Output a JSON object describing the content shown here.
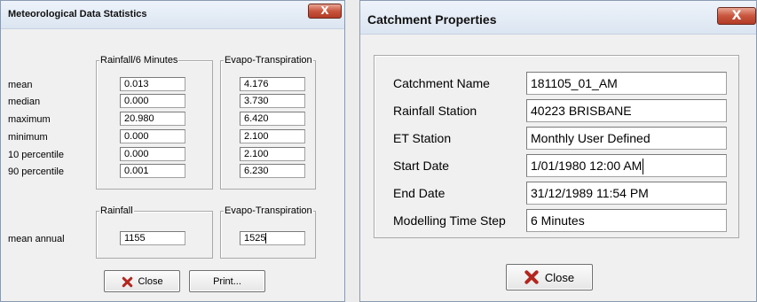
{
  "met_window": {
    "title": "Meteorological Data Statistics",
    "close_x": "X",
    "groups": {
      "rainfall6": "Rainfall/6 Minutes",
      "evapo1": "Evapo-Transpiration",
      "rainfall": "Rainfall",
      "evapo2": "Evapo-Transpiration"
    },
    "rows": [
      {
        "label": "mean",
        "rain": "0.013",
        "et": "4.176"
      },
      {
        "label": "median",
        "rain": "0.000",
        "et": "3.730"
      },
      {
        "label": "maximum",
        "rain": "20.980",
        "et": "6.420"
      },
      {
        "label": "minimum",
        "rain": "0.000",
        "et": "2.100"
      },
      {
        "label": "10 percentile",
        "rain": "0.000",
        "et": "2.100"
      },
      {
        "label": "90 percentile",
        "rain": "0.001",
        "et": "6.230"
      }
    ],
    "annual": {
      "label": "mean annual",
      "rain": "1155",
      "et": "1525"
    },
    "close_label": "Close",
    "print_label": "Print..."
  },
  "catchment_window": {
    "title": "Catchment Properties",
    "close_x": "X",
    "fields": [
      {
        "label": "Catchment Name",
        "value": "181105_01_AM"
      },
      {
        "label": "Rainfall Station",
        "value": "40223 BRISBANE"
      },
      {
        "label": "ET Station",
        "value": "Monthly User Defined"
      },
      {
        "label": "Start Date",
        "value": "1/01/1980 12:00 AM"
      },
      {
        "label": "End Date",
        "value": "31/12/1989 11:54 PM"
      },
      {
        "label": "Modelling Time Step",
        "value": "6 Minutes"
      }
    ],
    "close_label": "Close"
  },
  "colors": {
    "title_close_red": "#c9553d",
    "close_x_red": "#b3261e",
    "dialog_bg": "#f0f0f0"
  }
}
